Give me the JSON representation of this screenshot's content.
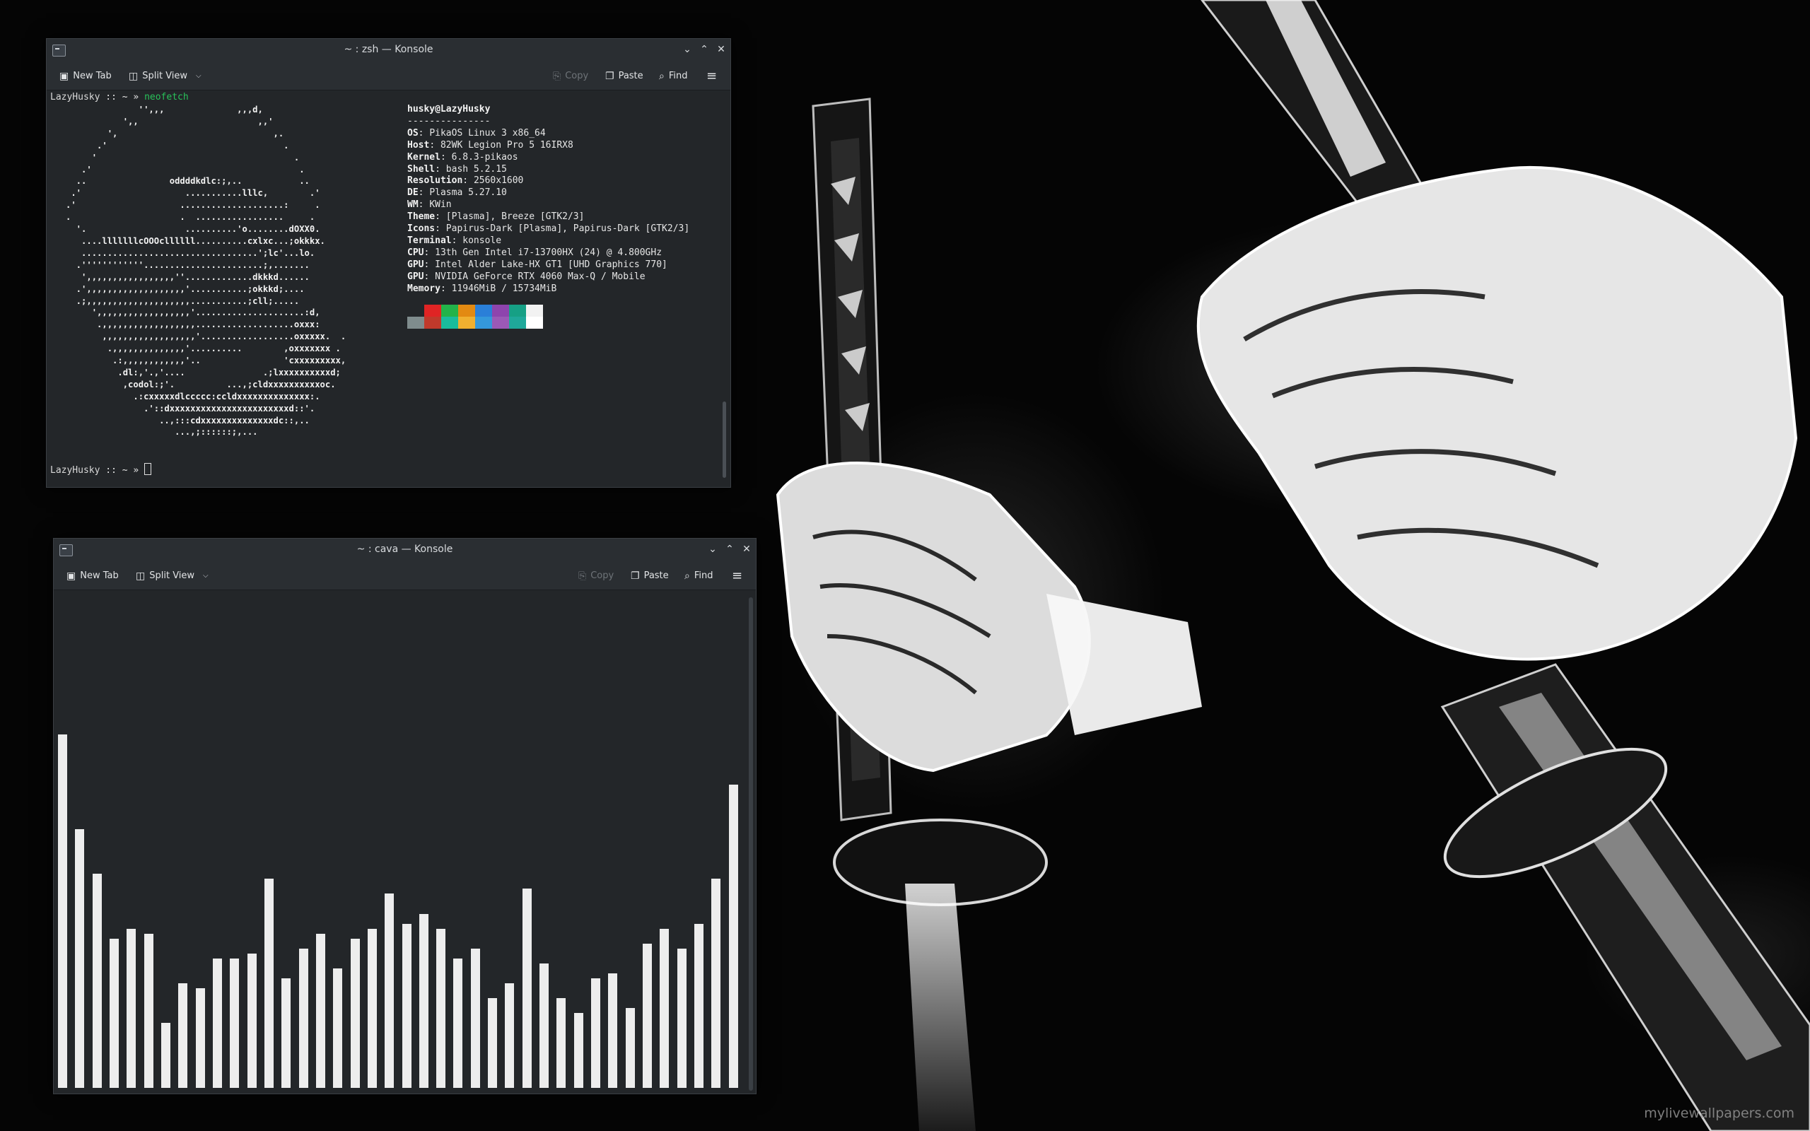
{
  "wallpaper": {
    "watermark": "mylivewallpapers.com"
  },
  "top_window": {
    "title": "~ : zsh — Konsole",
    "toolbar": {
      "new_tab": "New Tab",
      "split_view": "Split View",
      "copy": "Copy",
      "paste": "Paste",
      "find": "Find"
    },
    "prompt_host": "LazyHusky",
    "prompt_sep": " :: ~ » ",
    "command": "neofetch",
    "ascii_art": [
      "                 '',,,              ,,,d,",
      "              ',,                       ,,'",
      "           ',                              ,.",
      "         .'                                  .",
      "        '                                      .",
      "      .'                                        .",
      "     ..                oddddkdlc:;,..           ..",
      "    .'                    ...........lllc,        .'",
      "   .'                    ....................:     .",
      "   .                     .  .................     .",
      "     '.                   ..........'o........dOXX0.",
      "      ....lllllllcOOOcllllll..........cxlxc...;okkkx.",
      "      ..................................';lc'...lo.",
      "     .''''''''''''.......................;,.......",
      "      ',,,,,,,,,,,,,,,,,''.............dkkkd......",
      "     .',,,,,,,,,,,,,,,,,,,'...........;okkkd;....",
      "     .;,,,,,,,,,,,,,,,,,,,,...........;cll;.....",
      "        ',,,,,,,,,,,,,,,,,,'.....................:d,",
      "         .,,,,,,,,,,,,,,,,,,...................oxxx:",
      "          ,,,,,,,,,,,,,,,,,,'..................oxxxxx.  .",
      "           .,,,,,,,,,,,,,,'..........        ,oxxxxxxx .",
      "            .:,,,,,,,,,,,,'..                'cxxxxxxxxx,",
      "             .dl:,'.,'....               .;lxxxxxxxxxxd;",
      "              ,codol:;'.          ...,;cldxxxxxxxxxxoc.",
      "                .:cxxxxxdlccccc:ccldxxxxxxxxxxxxxx:.",
      "                  .'::dxxxxxxxxxxxxxxxxxxxxxxxd::'.",
      "                     ..,:::cdxxxxxxxxxxxxxxdc::,..",
      "                        ...,;::::::;,..."
    ],
    "info_header": "husky@LazyHusky",
    "info_rule": "---------------",
    "info": [
      {
        "key": "OS",
        "value": "PikaOS Linux 3 x86_64"
      },
      {
        "key": "Host",
        "value": "82WK Legion Pro 5 16IRX8"
      },
      {
        "key": "Kernel",
        "value": "6.8.3-pikaos"
      },
      {
        "key": "Shell",
        "value": "bash 5.2.15"
      },
      {
        "key": "Resolution",
        "value": "2560x1600"
      },
      {
        "key": "DE",
        "value": "Plasma 5.27.10"
      },
      {
        "key": "WM",
        "value": "KWin"
      },
      {
        "key": "Theme",
        "value": "[Plasma], Breeze [GTK2/3]"
      },
      {
        "key": "Icons",
        "value": "Papirus-Dark [Plasma], Papirus-Dark [GTK2/3]"
      },
      {
        "key": "Terminal",
        "value": "konsole"
      },
      {
        "key": "CPU",
        "value": "13th Gen Intel i7-13700HX (24) @ 4.800GHz"
      },
      {
        "key": "GPU",
        "value": "Intel Alder Lake-HX GT1 [UHD Graphics 770]"
      },
      {
        "key": "GPU",
        "value": "NVIDIA GeForce RTX 4060 Max-Q / Mobile"
      },
      {
        "key": "Memory",
        "value": "11946MiB / 15734MiB"
      }
    ],
    "palette_top": [
      "#232629",
      "#e02424",
      "#23b34a",
      "#e38a12",
      "#2a7fd8",
      "#8e44ad",
      "#16a085",
      "#f2f2f2"
    ],
    "palette_bottom": [
      "#7f8c8d",
      "#c0392b",
      "#1abc9c",
      "#f0b030",
      "#3498db",
      "#9b59b6",
      "#1fa89a",
      "#ffffff"
    ]
  },
  "bottom_window": {
    "title": "~ : cava — Konsole",
    "toolbar": {
      "new_tab": "New Tab",
      "split_view": "Split View",
      "copy": "Copy",
      "paste": "Paste",
      "find": "Find"
    },
    "visualizer_levels": [
      0.71,
      0.52,
      0.43,
      0.3,
      0.32,
      0.31,
      0.13,
      0.21,
      0.2,
      0.26,
      0.26,
      0.27,
      0.42,
      0.22,
      0.28,
      0.31,
      0.24,
      0.3,
      0.32,
      0.39,
      0.33,
      0.35,
      0.32,
      0.26,
      0.28,
      0.18,
      0.21,
      0.4,
      0.25,
      0.18,
      0.15,
      0.22,
      0.23,
      0.16,
      0.29,
      0.32,
      0.28,
      0.33,
      0.42,
      0.61
    ]
  }
}
